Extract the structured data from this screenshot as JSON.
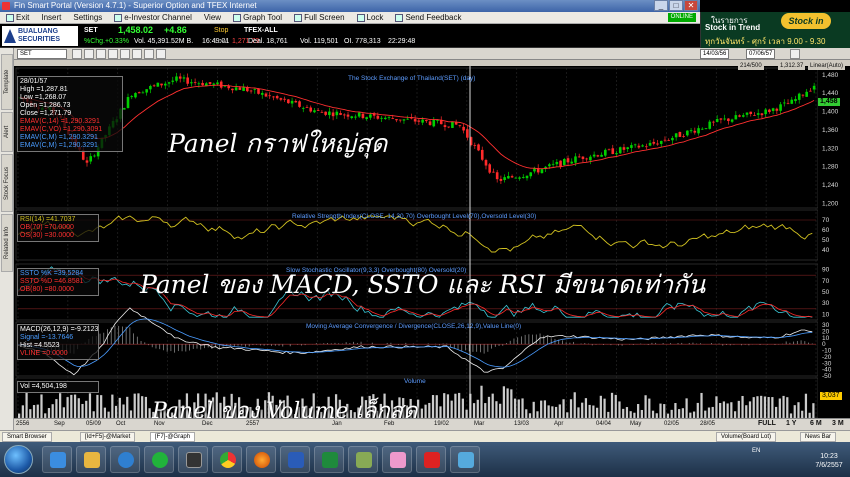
{
  "window": {
    "title": "Fin Smart Portal (Version 4.7.1) - Superior Option and TFEX Internet",
    "controls": [
      "_",
      "□",
      "✕"
    ]
  },
  "menu": {
    "items": [
      "Exit",
      "Insert",
      "Settings",
      "e-Investor Channel",
      "View",
      "Graph Tool",
      "Full Screen",
      "Lock",
      "Send Feedback"
    ],
    "online": "ONLINE"
  },
  "ticker": {
    "brand": "BUALUANG SECURITIES",
    "set_label": "SET",
    "set_value": "1,458.02",
    "set_change": "+4.86",
    "chg_pct": "%Chg.+0.33%",
    "vol": "Vol. 45,391.52M B.",
    "time": "16:49:01",
    "low_label": "Low",
    "low_value": "1,271.79",
    "stop_label": "Stop",
    "tfex_label": "TFEX-ALL",
    "deal": "Deal. 18,761",
    "vol2": "Vol. 119,501",
    "oi": "OI. 778,313",
    "time2": "22:29:48"
  },
  "ad": {
    "line1": "ในรายการ",
    "line2": "Stock in Trend",
    "logo": "Stock in Trend",
    "line3": "ทุกวันจันทร์ - ศุกร์ เวลา 9.00 - 9.30"
  },
  "side_tabs": [
    "Template",
    "Alert",
    "Stock Focus",
    "Related Info"
  ],
  "toolbar": {
    "symbol": "SET",
    "date_from": "14/03/56",
    "date_to": "07/06/57",
    "count": "214/500",
    "last": "1,312.37",
    "scale": "Linear(Auto)"
  },
  "panels": {
    "price": {
      "title": "The Stock Exchange of Thailand(SET) (day)",
      "info": {
        "date": "28/01/57",
        "high": "High  =1,287.81",
        "low": "Low   =1,268.07",
        "open": "Open  =1,286.73",
        "close": "Close =1,271.79",
        "ema1": "EMAV(C,14) =1,290.3291",
        "ema2": "EMAV(C,VO) =1,290.3091",
        "ema3": "EMAV(C,M) =1,290.3291",
        "ema4": "EMAV(C,M) =1,290.3291"
      },
      "last_tag": "1,458",
      "y_ticks": [
        "1,480",
        "1,440",
        "1,400",
        "1,360",
        "1,320",
        "1,280",
        "1,240",
        "1,200"
      ]
    },
    "rsi": {
      "title": "Relative Strength Index(CLOSE, 14,30,70) Overbought Level(70),Oversold Level(30)",
      "info": {
        "main": "RSI(14) =41.7037",
        "l2": "OB(70) =70.0000",
        "l3": "OS(30) =30.0000"
      },
      "y_ticks": [
        "70",
        "60",
        "50",
        "40"
      ]
    },
    "ssto": {
      "title": "Slow Stochastic Oscillator(9,3,3) Overbought(80) Oversold(20)",
      "info": {
        "k": "SSTO %K  =39.5284",
        "d": "SSTO %D  =46.8581",
        "l3": "OB(80) =80.0000"
      },
      "y_ticks": [
        "90",
        "70",
        "50",
        "30",
        "10"
      ]
    },
    "macd": {
      "title": "Moving Average Convergence / Divergence(CLOSE,26,12,9),Value Line(0)",
      "info": {
        "macd": "MACD(26,12,9) =-9.2123",
        "signal": "Signal  =-13.7646",
        "hist": "Hist   =4.5523",
        "vline": "VLINE   =0.0000"
      },
      "y_ticks": [
        "30",
        "20",
        "10",
        "0",
        "-10",
        "-20",
        "-30",
        "-40",
        "-50"
      ]
    },
    "volume": {
      "title": "Volume",
      "info": {
        "main": "Vol  =4,504,198"
      },
      "last_tag": "3,037"
    }
  },
  "overlays": {
    "price": "Panel กราฟใหญ่สุด",
    "middle": "Panel ของ MACD, SSTO และ RSI  มีขนาดเท่ากัน",
    "volume": "Panel ของ Volume เล็กสุด"
  },
  "time_axis": [
    "2556",
    "Sep",
    "05/09",
    "Oct",
    "Nov",
    "Dec",
    "2557",
    "Jan",
    "Feb",
    "19/02",
    "Mar",
    "13/03",
    "Apr",
    "04/04",
    "May",
    "02/05",
    "28/05"
  ],
  "timeframes": [
    "FULL",
    "1 Y",
    "6 M",
    "3 M"
  ],
  "status_tabs": [
    "Smart Browser",
    "[Id+F5]-@Market",
    "[F7]-@Graph",
    "Volume(Board Lot)",
    "News Bar"
  ],
  "clock": {
    "time": "10:23",
    "date": "7/6/2557",
    "lang": "EN"
  },
  "colors": {
    "up": "#00d000",
    "down": "#ff2a2a",
    "ema": "#ff3030",
    "ob": "#d0c020",
    "line_blue": "#4a9cff",
    "grid": "#2a2a2a"
  }
}
